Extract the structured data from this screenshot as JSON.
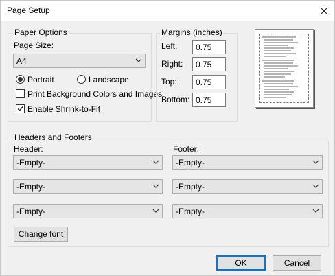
{
  "window": {
    "title": "Page Setup"
  },
  "paper_options": {
    "group_title": "Paper Options",
    "page_size_label": "Page Size:",
    "page_size_value": "A4",
    "portrait_label": "Portrait",
    "portrait_checked": true,
    "landscape_label": "Landscape",
    "landscape_checked": false,
    "print_bg_label": "Print Background Colors and Images",
    "print_bg_checked": false,
    "shrink_label": "Enable Shrink-to-Fit",
    "shrink_checked": true
  },
  "margins": {
    "group_title": "Margins (inches)",
    "left_label": "Left:",
    "left_value": "0.75",
    "right_label": "Right:",
    "right_value": "0.75",
    "top_label": "Top:",
    "top_value": "0.75",
    "bottom_label": "Bottom:",
    "bottom_value": "0.75"
  },
  "headers_footers": {
    "group_title": "Headers and Footers",
    "header_label": "Header:",
    "footer_label": "Footer:",
    "header_values": [
      "-Empty-",
      "-Empty-",
      "-Empty-"
    ],
    "footer_values": [
      "-Empty-",
      "-Empty-",
      "-Empty-"
    ],
    "change_font_label": "Change font"
  },
  "buttons": {
    "ok_label": "OK",
    "cancel_label": "Cancel"
  },
  "colors": {
    "dialog_bg": "#f0f0f0",
    "accent": "#0078d7",
    "border": "#adadad"
  },
  "icons": {
    "close": "close-icon",
    "dropdown": "chevron-down-icon"
  }
}
